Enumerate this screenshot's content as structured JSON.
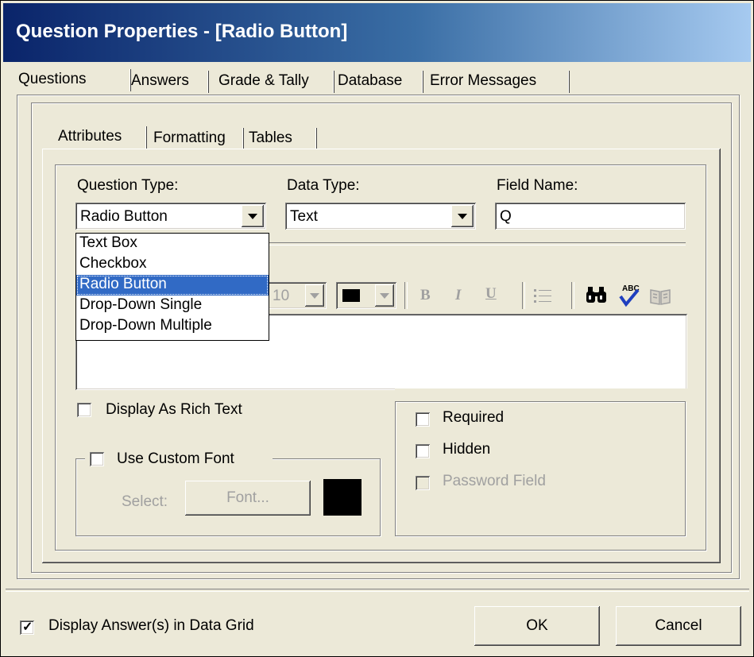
{
  "window": {
    "title": "Question Properties - [Radio Button]"
  },
  "outer_tabs": [
    {
      "label": "Questions"
    },
    {
      "label": "Answers"
    },
    {
      "label": "Grade & Tally"
    },
    {
      "label": "Database"
    },
    {
      "label": "Error Messages"
    }
  ],
  "inner_tabs": [
    {
      "label": "Attributes"
    },
    {
      "label": "Formatting"
    },
    {
      "label": "Tables"
    }
  ],
  "fields": {
    "question_type": {
      "label": "Question Type:",
      "value": "Radio Button"
    },
    "data_type": {
      "label": "Data Type:",
      "value": "Text"
    },
    "field_name": {
      "label": "Field Name:",
      "value": "Q"
    }
  },
  "dropdown_options": [
    "Text Box",
    "Checkbox",
    "Radio Button",
    "Drop-Down Single",
    "Drop-Down Multiple"
  ],
  "toolbar": {
    "font_size": "10",
    "bold": "B",
    "italic": "I",
    "underline": "U"
  },
  "options": {
    "display_rich_text": {
      "label": "Display As Rich Text",
      "checked": false
    },
    "use_custom_font": {
      "label": "Use Custom Font",
      "checked": false
    },
    "select_label": "Select:",
    "font_button": "Font...",
    "font_color": "#000000",
    "required": {
      "label": "Required",
      "checked": false
    },
    "hidden": {
      "label": "Hidden",
      "checked": false
    },
    "password_field": {
      "label": "Password Field",
      "checked": false,
      "enabled": false
    }
  },
  "footer": {
    "display_answers": {
      "label": "Display Answer(s) in Data Grid",
      "checked": true
    },
    "ok": "OK",
    "cancel": "Cancel"
  },
  "icons": [
    "binoculars-icon",
    "spellcheck-icon",
    "book-icon",
    "list-icon",
    "color-swatch-icon"
  ],
  "colors": {
    "titlebar_start": "#0a246a",
    "titlebar_end": "#a6caf0",
    "selection": "#316ac5",
    "face": "#ece9d8"
  }
}
